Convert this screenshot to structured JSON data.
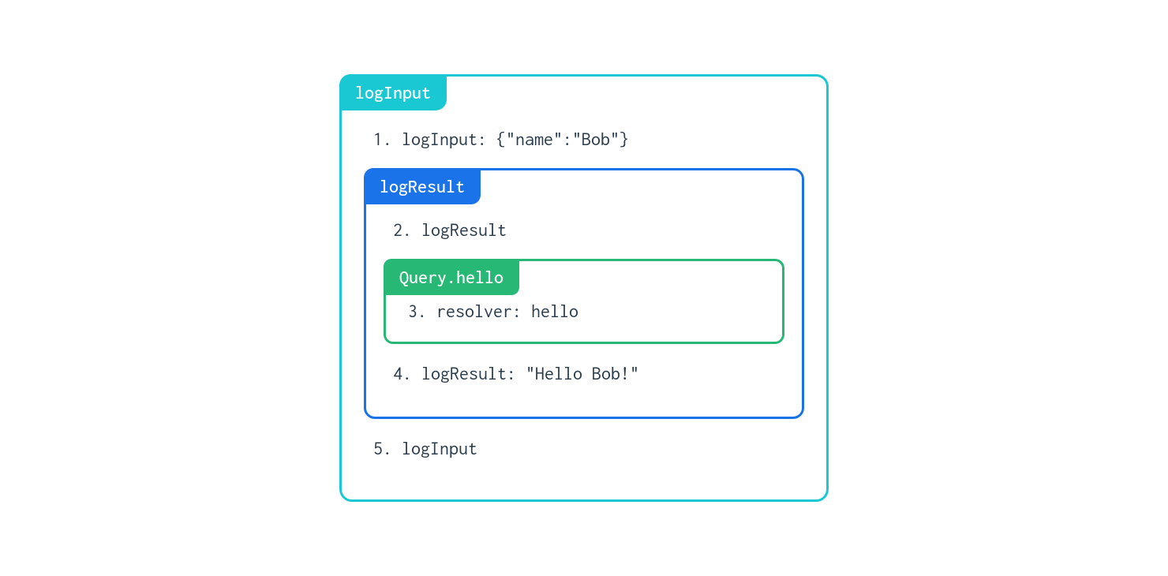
{
  "outer": {
    "label": "logInput",
    "step1": "1. logInput: {\"name\":\"Bob\"}",
    "step5": "5. logInput",
    "border_color": "#1ac8d4"
  },
  "middle": {
    "label": "logResult",
    "step2": "2. logResult",
    "step4": "4. logResult: \"Hello Bob!\"",
    "border_color": "#1a73e8"
  },
  "inner": {
    "label": "Query.hello",
    "step3": "3. resolver: hello",
    "border_color": "#28b875"
  }
}
